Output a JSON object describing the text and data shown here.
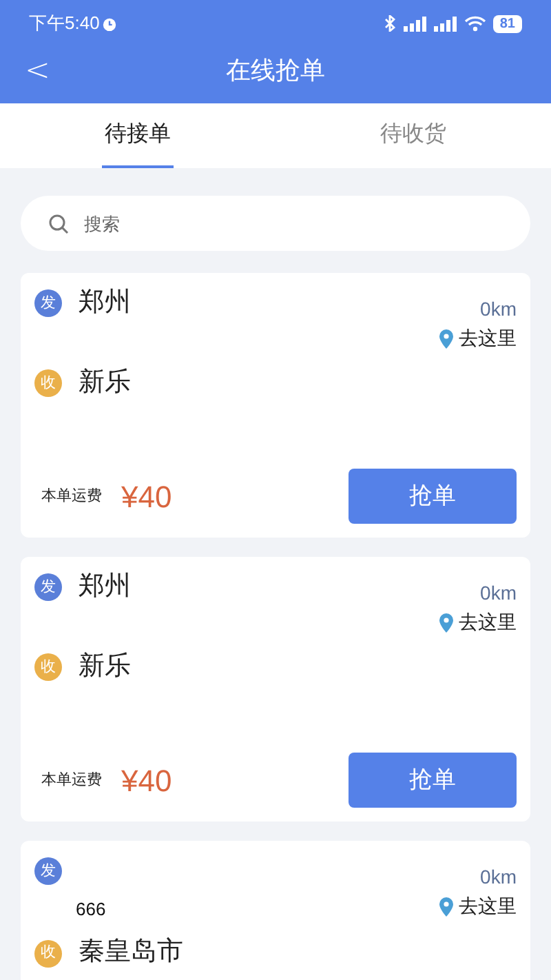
{
  "status_bar": {
    "time": "下午5:40",
    "battery": "81"
  },
  "header": {
    "back": "<",
    "title": "在线抢单"
  },
  "tabs": [
    {
      "label": "待接单",
      "selected": true
    },
    {
      "label": "待收货",
      "selected": false
    }
  ],
  "search": {
    "placeholder": "搜索"
  },
  "orders": [
    {
      "from": {
        "badge": "发",
        "city": "郑州"
      },
      "to": {
        "badge": "收",
        "city": "新乐"
      },
      "distance": "0km",
      "navigate": "去这里",
      "fee_label": "本单运费",
      "fee": "¥40",
      "action": "抢单"
    },
    {
      "from": {
        "badge": "发",
        "city": "郑州"
      },
      "to": {
        "badge": "收",
        "city": "新乐"
      },
      "distance": "0km",
      "navigate": "去这里",
      "fee_label": "本单运费",
      "fee": "¥40",
      "action": "抢单"
    },
    {
      "from": {
        "badge": "发",
        "note": "666"
      },
      "to": {
        "badge": "收",
        "city": "秦皇岛市"
      },
      "distance": "0km",
      "navigate": "去这里"
    }
  ]
}
